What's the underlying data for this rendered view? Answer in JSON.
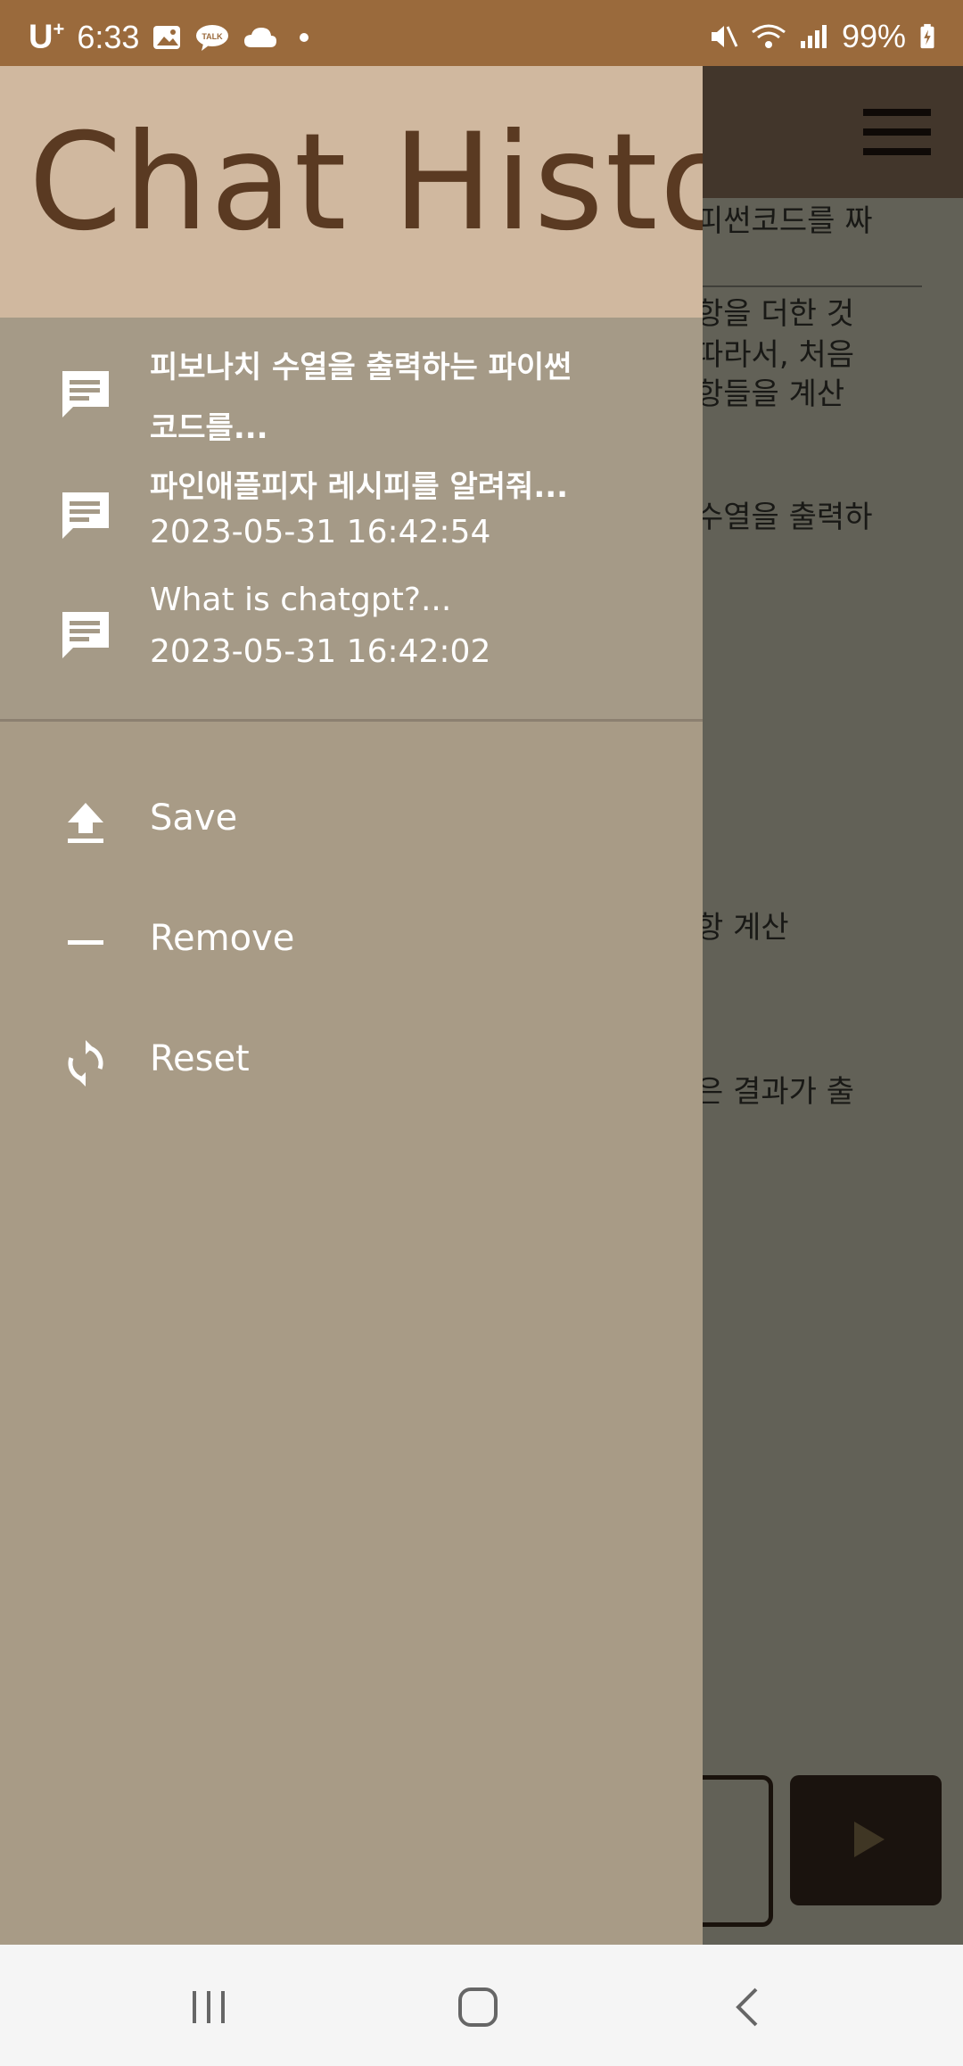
{
  "status_bar": {
    "carrier": "U",
    "carrier_sup": "+",
    "time": "6:33",
    "talk_badge": "TALK",
    "battery": "99%"
  },
  "background": {
    "lines": [
      "피썬코드를 짜",
      "항을 더한 것",
      "따라서, 처음",
      "항들을 계산",
      "수열을 출력하",
      "항 계산",
      "은 결과가 출"
    ]
  },
  "drawer": {
    "title": "Chat History",
    "history": [
      {
        "title": "피보나치 수열을 출력하는 파이썬",
        "title_cont": "코드를...",
        "date": "",
        "icon": "chat-icon"
      },
      {
        "title": "파인애플피자 레시피를 알려줘...",
        "date": "2023-05-31 16:42:54",
        "icon": "chat-icon"
      },
      {
        "title": "What is chatgpt?...",
        "date": "2023-05-31 16:42:02",
        "icon": "chat-icon"
      }
    ],
    "menu": [
      {
        "label": "Save",
        "icon": "upload-icon"
      },
      {
        "label": "Remove",
        "icon": "minus-icon"
      },
      {
        "label": "Reset",
        "icon": "refresh-icon"
      }
    ]
  },
  "colors": {
    "status_bar": "#9a6a3c",
    "drawer_header": "#d0b89f",
    "drawer_body": "#a89b86",
    "title_text": "#5a3a22"
  }
}
